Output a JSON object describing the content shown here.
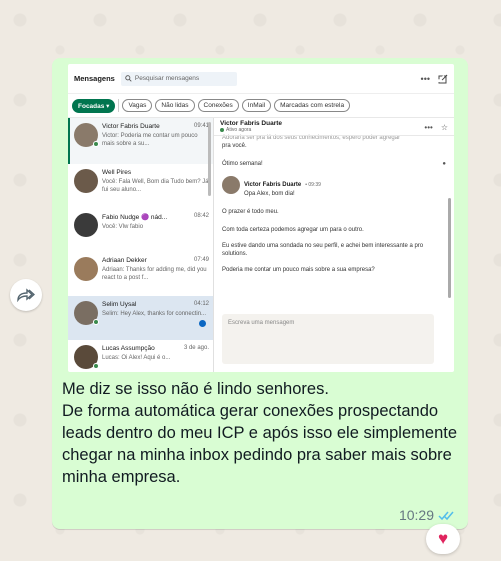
{
  "colors": {
    "bubble": "#d9fdd3",
    "linkedin_green": "#01754f",
    "read_ticks": "#53bdeb",
    "reaction_heart": "#e0245e"
  },
  "forward_icon": "forward-arrow-icon",
  "screenshot": {
    "title": "Mensagens",
    "search_placeholder": "Pesquisar mensagens",
    "top_icons": [
      "more-icon",
      "compose-icon"
    ],
    "filters": [
      {
        "label": "Focadas ▾",
        "active": true
      },
      {
        "label": "Vagas",
        "active": false
      },
      {
        "label": "Não lidas",
        "active": false
      },
      {
        "label": "Conexões",
        "active": false
      },
      {
        "label": "InMail",
        "active": false
      },
      {
        "label": "Marcadas com estrela",
        "active": false
      }
    ],
    "conversations": [
      {
        "name": "Victor Fabris Duarte",
        "date": "09:41",
        "preview": "Victor: Poderia me contar um pouco mais sobre a su...",
        "color": "#8a7a6a",
        "online": true,
        "selected": false,
        "unread": false
      },
      {
        "name": "Well Pires",
        "date": "",
        "preview": "Você: Fala Well, Bom dia Tudo bem? Já fui seu aluno...",
        "color": "#6b5a4a",
        "online": false,
        "selected": false,
        "unread": false
      },
      {
        "name": "Fabio Nudge 🟣 nád...",
        "date": "08:42",
        "preview": "Você: Vlw fabio",
        "color": "#3a3a3a",
        "online": false,
        "selected": false,
        "unread": false
      },
      {
        "name": "Adriaan Dekker",
        "date": "07:49",
        "preview": "Adriaan: Thanks for adding me, did you react to a post f...",
        "color": "#9a7b5c",
        "online": false,
        "selected": false,
        "unread": false
      },
      {
        "name": "Selim Uysal",
        "date": "04:12",
        "preview": "Selim: Hey Alex, thanks for connectin...",
        "color": "#7a6e62",
        "online": true,
        "selected": true,
        "unread": true
      },
      {
        "name": "Lucas Assumpção",
        "date": "3 de ago.",
        "preview": "Lucas: Oi Alex! Aqui é o...",
        "color": "#5a4a3a",
        "online": true,
        "selected": false,
        "unread": false
      }
    ],
    "chat": {
      "name": "Victor Fabris Duarte",
      "status": "Ativo agora",
      "head_icons": [
        "more-icon",
        "star-icon"
      ],
      "partial_top": "Adoraria ser pra lá dos seus conhecimentos, espero poder agregar",
      "msg_top": "pra você.",
      "sent_msg": "Ótimo semana!",
      "author": "Victor Fabris Duarte",
      "time": "• 09:39",
      "lines": [
        "Opa Alex, bom dia!",
        "O prazer é todo meu.",
        "Com toda certeza podemos agregar um para o outro.",
        "Eu estive dando uma sondada no seu perfil, e achei bem interessante a pro solutions.",
        "Poderia me contar um pouco mais sobre a sua empresa?"
      ],
      "compose_placeholder": "Escreva uma mensagem"
    }
  },
  "caption": "Me diz se isso não é lindo senhores.\nDe forma automática gerar conexões prospectando leads dentro do meu ICP e após isso ele simplemente chegar na minha inbox pedindo pra saber mais sobre minha empresa.",
  "time": "10:29",
  "reaction": "♥"
}
